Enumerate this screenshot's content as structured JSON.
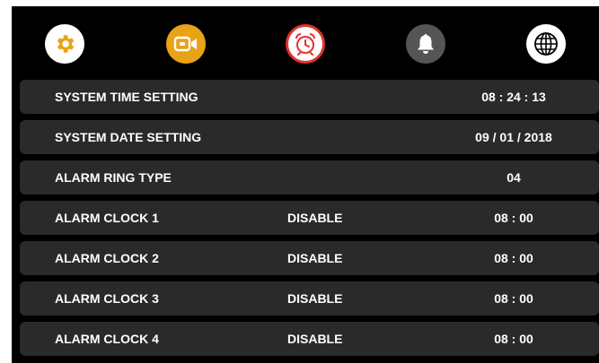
{
  "tabs": [
    {
      "icon": "gear-icon",
      "color": "#e8a317"
    },
    {
      "icon": "video-camera-icon",
      "color": "#e8a317"
    },
    {
      "icon": "alarm-clock-icon",
      "color": "#e4312b"
    },
    {
      "icon": "bell-icon",
      "color": "#555555"
    },
    {
      "icon": "globe-icon",
      "color": "#000000"
    }
  ],
  "rows": [
    {
      "label": "SYSTEM TIME SETTING",
      "status": "",
      "value": "08 : 24 : 13"
    },
    {
      "label": "SYSTEM DATE SETTING",
      "status": "",
      "value": "09 / 01 / 2018"
    },
    {
      "label": "ALARM RING TYPE",
      "status": "",
      "value": "04"
    },
    {
      "label": "ALARM CLOCK 1",
      "status": "DISABLE",
      "value": "08 : 00"
    },
    {
      "label": "ALARM CLOCK 2",
      "status": "DISABLE",
      "value": "08 : 00"
    },
    {
      "label": "ALARM CLOCK 3",
      "status": "DISABLE",
      "value": "08 : 00"
    },
    {
      "label": "ALARM CLOCK 4",
      "status": "DISABLE",
      "value": "08 : 00"
    }
  ]
}
